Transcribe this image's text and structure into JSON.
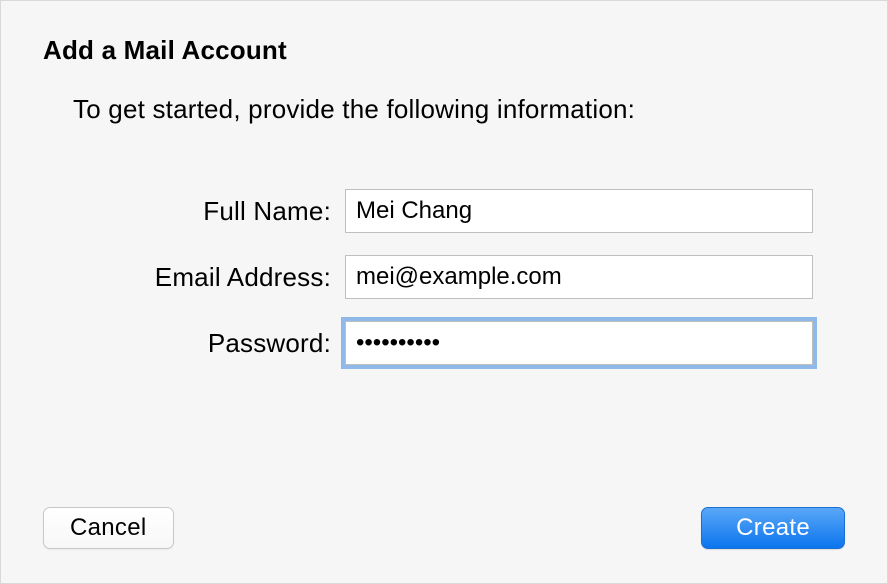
{
  "dialog": {
    "title": "Add a Mail Account",
    "subtitle": "To get started, provide the following information:"
  },
  "form": {
    "fullName": {
      "label": "Full Name:",
      "value": "Mei Chang"
    },
    "email": {
      "label": "Email Address:",
      "value": "mei@example.com"
    },
    "password": {
      "label": "Password:",
      "value": "••••••••••"
    }
  },
  "buttons": {
    "cancel": "Cancel",
    "create": "Create"
  }
}
